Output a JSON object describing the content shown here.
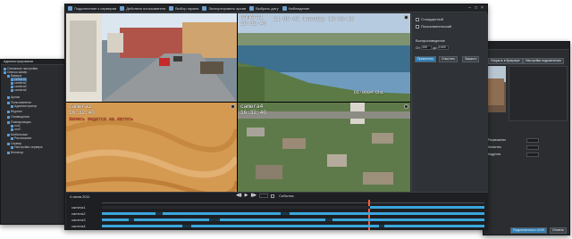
{
  "main": {
    "toolbar": [
      {
        "label": "Подключение к серверам"
      },
      {
        "label": "Действия пользователя"
      },
      {
        "label": "Выбор экрана"
      },
      {
        "label": "Экспортировать архив"
      },
      {
        "label": "Выбрать дату"
      },
      {
        "label": "Наблюдение"
      }
    ],
    "cameras": [
      {
        "name": "",
        "time": "",
        "label_text": ""
      },
      {
        "name": "camera1",
        "time": "16:32:43",
        "stamp": "11-06-02 Tuesday 16:33:18",
        "bottom_stamp": "D1-0604 Ch1"
      },
      {
        "name": "camera2",
        "time": "16:32:40",
        "note": "Запись ведется на Автось"
      },
      {
        "name": "camera4",
        "time": "16:32:40"
      }
    ],
    "right_panel": {
      "mode_standard": "Стандартный",
      "mode_user": "Пользовательский",
      "playback_label": "Воспроизведение",
      "from_label": "От",
      "from_value": "100",
      "to_label": "до",
      "to_value": "1440",
      "btn_apply": "Применить",
      "btn_clear": "Очистить",
      "btn_close": "Закрыть"
    },
    "timeline": {
      "date": "4 июня 2011",
      "events_label": "События",
      "rows": [
        {
          "name": "camera1"
        },
        {
          "name": "camera2"
        },
        {
          "name": "camera3"
        },
        {
          "name": "camera4"
        }
      ]
    }
  },
  "left": {
    "title": "Администрирование",
    "items": [
      "Основные настройки",
      "Список камер",
      "Камера",
      "camera1",
      "camera2",
      "camera3",
      "camera4",
      "Архив",
      "Пользователи",
      "Администратор",
      "Журнал",
      "Оповещения",
      "Планировщик",
      "ocr1",
      "ocr2",
      "Мобильные",
      "Расписание",
      "Сервер",
      "Настройки сервера",
      "Монитор"
    ]
  },
  "right": {
    "btn_open": "Открыть в браузере",
    "btn_settings": "Настройки подключения",
    "field1": "Разрешение",
    "field2": "Качество",
    "field3": "Кадр/сек",
    "btn_connect": "Подключиться к AXIS",
    "btn_close": "Отмена"
  },
  "colors": {
    "window_bg": "#2b2d30",
    "timeline_segment": "#3aa7dc",
    "accent_button": "#2f7fb5"
  }
}
